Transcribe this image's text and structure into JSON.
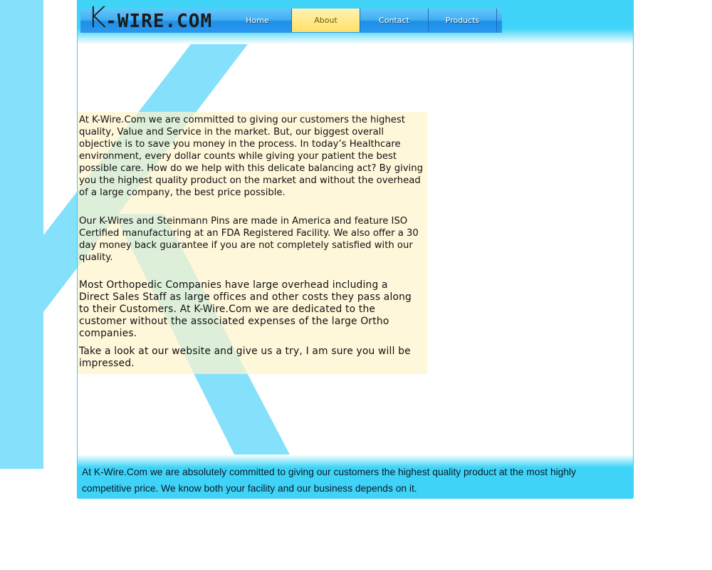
{
  "logo": {
    "k": "K",
    "rest": "-WIRE.COM"
  },
  "nav": [
    {
      "label": "Home",
      "active": false
    },
    {
      "label": "About",
      "active": true
    },
    {
      "label": "Contact",
      "active": false
    },
    {
      "label": "Products",
      "active": false
    }
  ],
  "content": {
    "p1": "At K-Wire.Com we are committed to giving our customers the highest quality, Value and Service in the market. But, our biggest overall objective is to save you money in the process. In today’s Healthcare environment, every dollar counts while giving your patient the best possible care. How do we help with this delicate balancing act? By giving you the highest quality product on the market and without the overhead of a large company, the best price possible.",
    "p2": "Our K-Wires and Steinmann Pins are made in America and feature ISO Certified manufacturing at an FDA Registered Facility. We also offer a 30 day money back guarantee if you are not completely satisfied with our quality.",
    "p3": "Most Orthopedic Companies have large overhead including a Direct Sales Staff as large offices and other costs they pass along to their Customers. At K-Wire.Com we are dedicated to the customer without the associated expenses of the large Ortho companies.",
    "p4": "Take a look at our website and give us a try, I am sure you will be impressed."
  },
  "footer": {
    "text": "At K-Wire.Com we are absolutely committed to giving our customers the highest quality product at the most highly competitive price.  We know both your facility and our business depends on it."
  },
  "colors": {
    "accent": "#3fd4f7",
    "k_shape": "#85e0fc",
    "nav_active": "#ffe98a",
    "content_bg": "#fff4cc"
  }
}
